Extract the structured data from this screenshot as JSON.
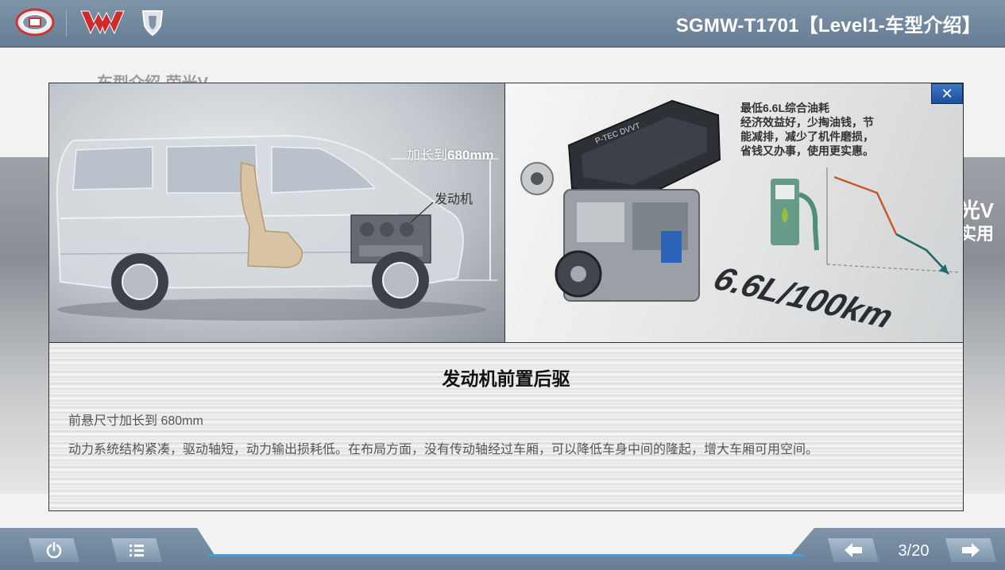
{
  "header": {
    "title": "SGMW-T1701【Level1-车型介绍】",
    "logos": [
      "sgmw-logo",
      "wuling-logo",
      "baojun-logo"
    ]
  },
  "background_slide": {
    "heading": "车型介绍-荣光V",
    "side_text_line1": "光V",
    "side_text_line2": "实用"
  },
  "popup": {
    "close_label": "✕",
    "left_image": {
      "annotation_length_prefix": "加长到",
      "annotation_length_value": "680mm",
      "annotation_engine": "发动机"
    },
    "right_image": {
      "text_line1": "最低6.6L综合油耗",
      "text_line2": "经济效益好，少掏油钱，节",
      "text_line3": "能减排，减少了机件磨损，",
      "text_line4": "省钱又办事，使用更实惠。",
      "engine_badge": "P-TEC  DVVT",
      "consumption": "6.6L/100km"
    },
    "caption": {
      "title": "发动机前置后驱",
      "line1": "前悬尺寸加长到 680mm",
      "line2": "动力系统结构紧凑，驱动轴短，动力输出损耗低。在布局方面，没有传动轴经过车厢，可以降低车身中间的隆起，增大车厢可用空间。"
    }
  },
  "footer": {
    "page_indicator": "3/20",
    "buttons": [
      "power-icon",
      "menu-icon",
      "arrow-left-icon",
      "arrow-right-icon"
    ]
  },
  "colors": {
    "bar": "#6f869c",
    "accent_line": "#4e9bd3",
    "close_button": "#2a60ad"
  }
}
